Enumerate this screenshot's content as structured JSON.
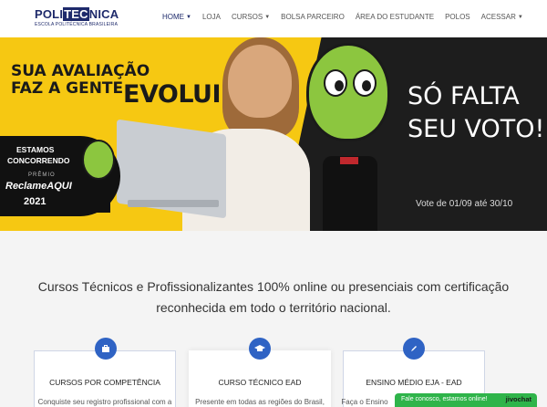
{
  "brand": {
    "logo_pre": "POLI",
    "logo_mid": "TEC",
    "logo_post": "NICA",
    "logo_sub": "ESCOLA POLITÉCNICA BRASILEIRA"
  },
  "nav": {
    "items": [
      {
        "label": "HOME",
        "caret": true,
        "active": true
      },
      {
        "label": "LOJA",
        "caret": false
      },
      {
        "label": "CURSOS",
        "caret": true
      },
      {
        "label": "BOLSA PARCEIRO",
        "caret": false
      },
      {
        "label": "ÁREA DO ESTUDANTE",
        "caret": false
      },
      {
        "label": "POLOS",
        "caret": false
      },
      {
        "label": "ACESSAR",
        "caret": true
      }
    ]
  },
  "banner": {
    "headline_line1": "SUA AVALIAÇÃO",
    "headline_line2": "FAZ A GENTE",
    "headline_big": "EVOLUIR",
    "badge_line1": "ESTAMOS",
    "badge_line2": "CONCORRENDO",
    "badge_premio": "PRÊMIO",
    "badge_brand": "ReclameAQUI",
    "badge_year": "2021",
    "cta_line1": "SÓ FALTA",
    "cta_line2": "SEU VOTO!",
    "vote_period": "Vote de 01/09 até 30/10"
  },
  "intro": {
    "text": "Cursos Técnicos e Profissionalizantes 100% online ou presenciais com certificação reconhecida em todo o território nacional."
  },
  "cards": [
    {
      "title": "CURSOS POR COMPETÊNCIA",
      "text": "Conquiste seu registro profissional com a",
      "icon": "briefcase-icon"
    },
    {
      "title": "CURSO TÉCNICO EAD",
      "text": "Presente em todas as regiões do Brasil,",
      "icon": "graduation-cap-icon"
    },
    {
      "title": "ENSINO MÉDIO EJA - EAD",
      "text": "Faça o Ensino",
      "icon": "pencil-icon"
    }
  ],
  "chat": {
    "label": "Fale conosco, estamos online!",
    "brand": "jivochat"
  },
  "colors": {
    "primary_navy": "#1e2a6b",
    "banner_yellow": "#f6c812",
    "icon_blue": "#2f63c4",
    "chat_green": "#2fb44a"
  }
}
